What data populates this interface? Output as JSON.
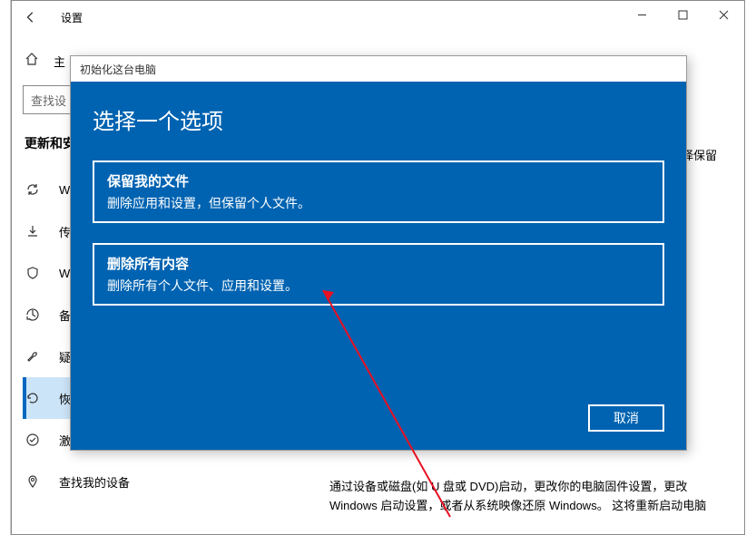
{
  "window": {
    "title": "设置",
    "controls": {
      "min": "—",
      "max": "□",
      "close": "✕"
    }
  },
  "sidebar": {
    "home": "主",
    "search_placeholder": "查找设",
    "section": "更新和安",
    "items": [
      {
        "label": "Wi"
      },
      {
        "label": "传递"
      },
      {
        "label": "Wir"
      },
      {
        "label": "备份"
      },
      {
        "label": "疑难"
      },
      {
        "label": "恢复"
      },
      {
        "label": "激活"
      },
      {
        "label": "查找我的设备"
      }
    ]
  },
  "main": {
    "right_fragment": "择保留",
    "bottom_text": "通过设备或磁盘(如 U 盘或 DVD)启动，更改你的电脑固件设置，更改 Windows 启动设置，或者从系统映像还原 Windows。  这将重新启动电脑"
  },
  "modal": {
    "titlebar": "初始化这台电脑",
    "heading": "选择一个选项",
    "options": [
      {
        "title": "保留我的文件",
        "desc": "删除应用和设置，但保留个人文件。"
      },
      {
        "title": "删除所有内容",
        "desc": "删除所有个人文件、应用和设置。"
      }
    ],
    "cancel": "取消"
  }
}
